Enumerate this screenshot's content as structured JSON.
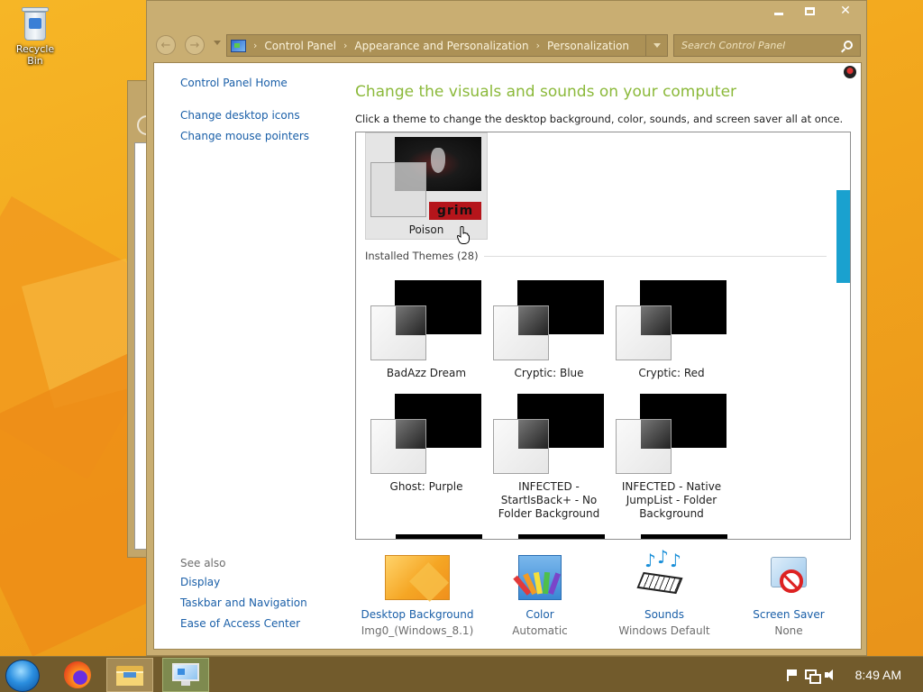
{
  "desktop": {
    "recycle_bin_label": "Recycle Bin"
  },
  "window": {
    "address": {
      "crumbs": [
        "Control Panel",
        "Appearance and Personalization",
        "Personalization"
      ]
    },
    "search": {
      "placeholder": "Search Control Panel"
    }
  },
  "leftnav": {
    "home": "Control Panel Home",
    "links": [
      "Change desktop icons",
      "Change mouse pointers"
    ],
    "see_also": {
      "header": "See also",
      "links": [
        "Display",
        "Taskbar and Navigation",
        "Ease of Access Center"
      ]
    }
  },
  "main": {
    "heading": "Change the visuals and sounds on your computer",
    "subheading": "Click a theme to change the desktop background, color, sounds, and screen saver all at once.",
    "selected_theme": {
      "name": "Poison",
      "badge": "grim"
    },
    "installed_label": "Installed Themes (28)",
    "themes": [
      {
        "name": "BadAzz Dream"
      },
      {
        "name": "Cryptic: Blue"
      },
      {
        "name": "Cryptic: Red"
      },
      {
        "name": "Ghost: Purple"
      },
      {
        "name": "INFECTED - StartIsBack+ - No Folder Background"
      },
      {
        "name": "INFECTED - Native JumpList - Folder Background"
      }
    ],
    "bottom": [
      {
        "title": "Desktop Background",
        "sub": "Img0_(Windows_8.1)",
        "icon": "wallpaper-icon"
      },
      {
        "title": "Color",
        "sub": "Automatic",
        "icon": "color-icon"
      },
      {
        "title": "Sounds",
        "sub": "Windows Default",
        "icon": "sounds-icon"
      },
      {
        "title": "Screen Saver",
        "sub": "None",
        "icon": "screensaver-icon"
      }
    ]
  },
  "taskbar": {
    "clock": "8:49 AM"
  },
  "colors": {
    "accent": "#8bb93a",
    "link": "#1a5fa8",
    "scroll_thumb": "#1aa1cf",
    "frame": "#c9ae72"
  }
}
